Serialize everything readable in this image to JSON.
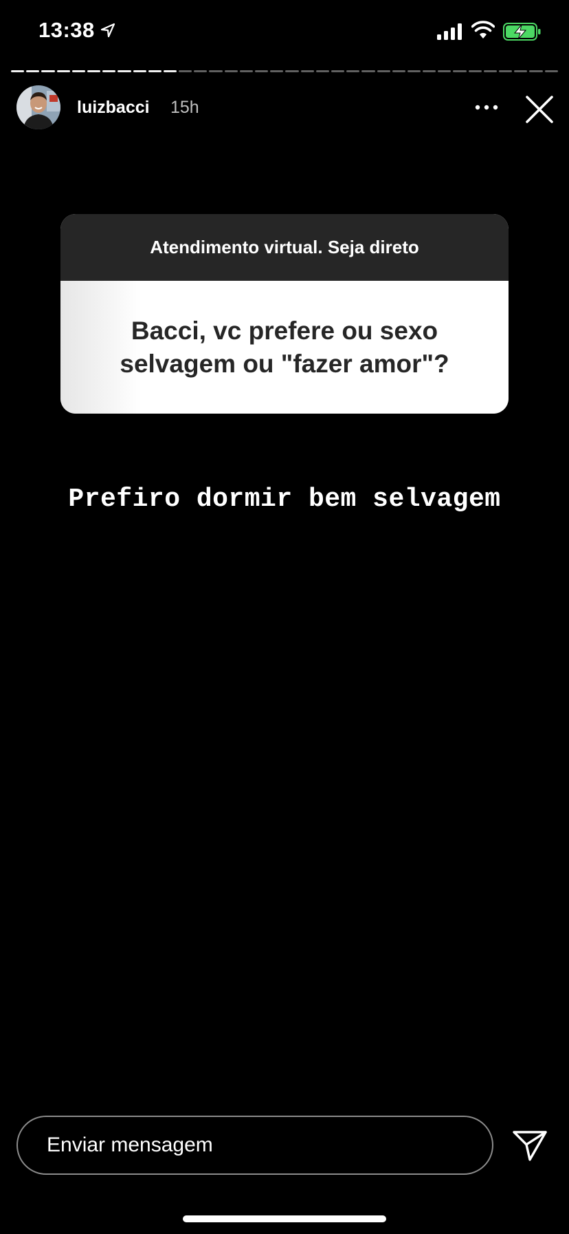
{
  "status_bar": {
    "time": "13:38",
    "icons": [
      "location-arrow-icon",
      "cellular-signal-icon",
      "wifi-icon",
      "battery-charging-icon"
    ],
    "battery_color": "#4cd964"
  },
  "story": {
    "progress": {
      "segments_total": 36,
      "segments_viewed": 11
    },
    "username": "luizbacci",
    "time_ago": "15h",
    "icons": [
      "more-options-icon",
      "close-icon"
    ]
  },
  "question_sticker": {
    "prompt": "Atendimento virtual. Seja direto",
    "question": "Bacci, vc prefere ou sexo\nselvagem ou \"fazer amor\"?"
  },
  "answer": "Prefiro dormir bem selvagem",
  "reply_bar": {
    "placeholder": "Enviar mensagem",
    "send_icon": "send-icon"
  },
  "colors": {
    "background": "#000000",
    "sticker_header": "#262626",
    "sticker_body": "#ffffff"
  }
}
